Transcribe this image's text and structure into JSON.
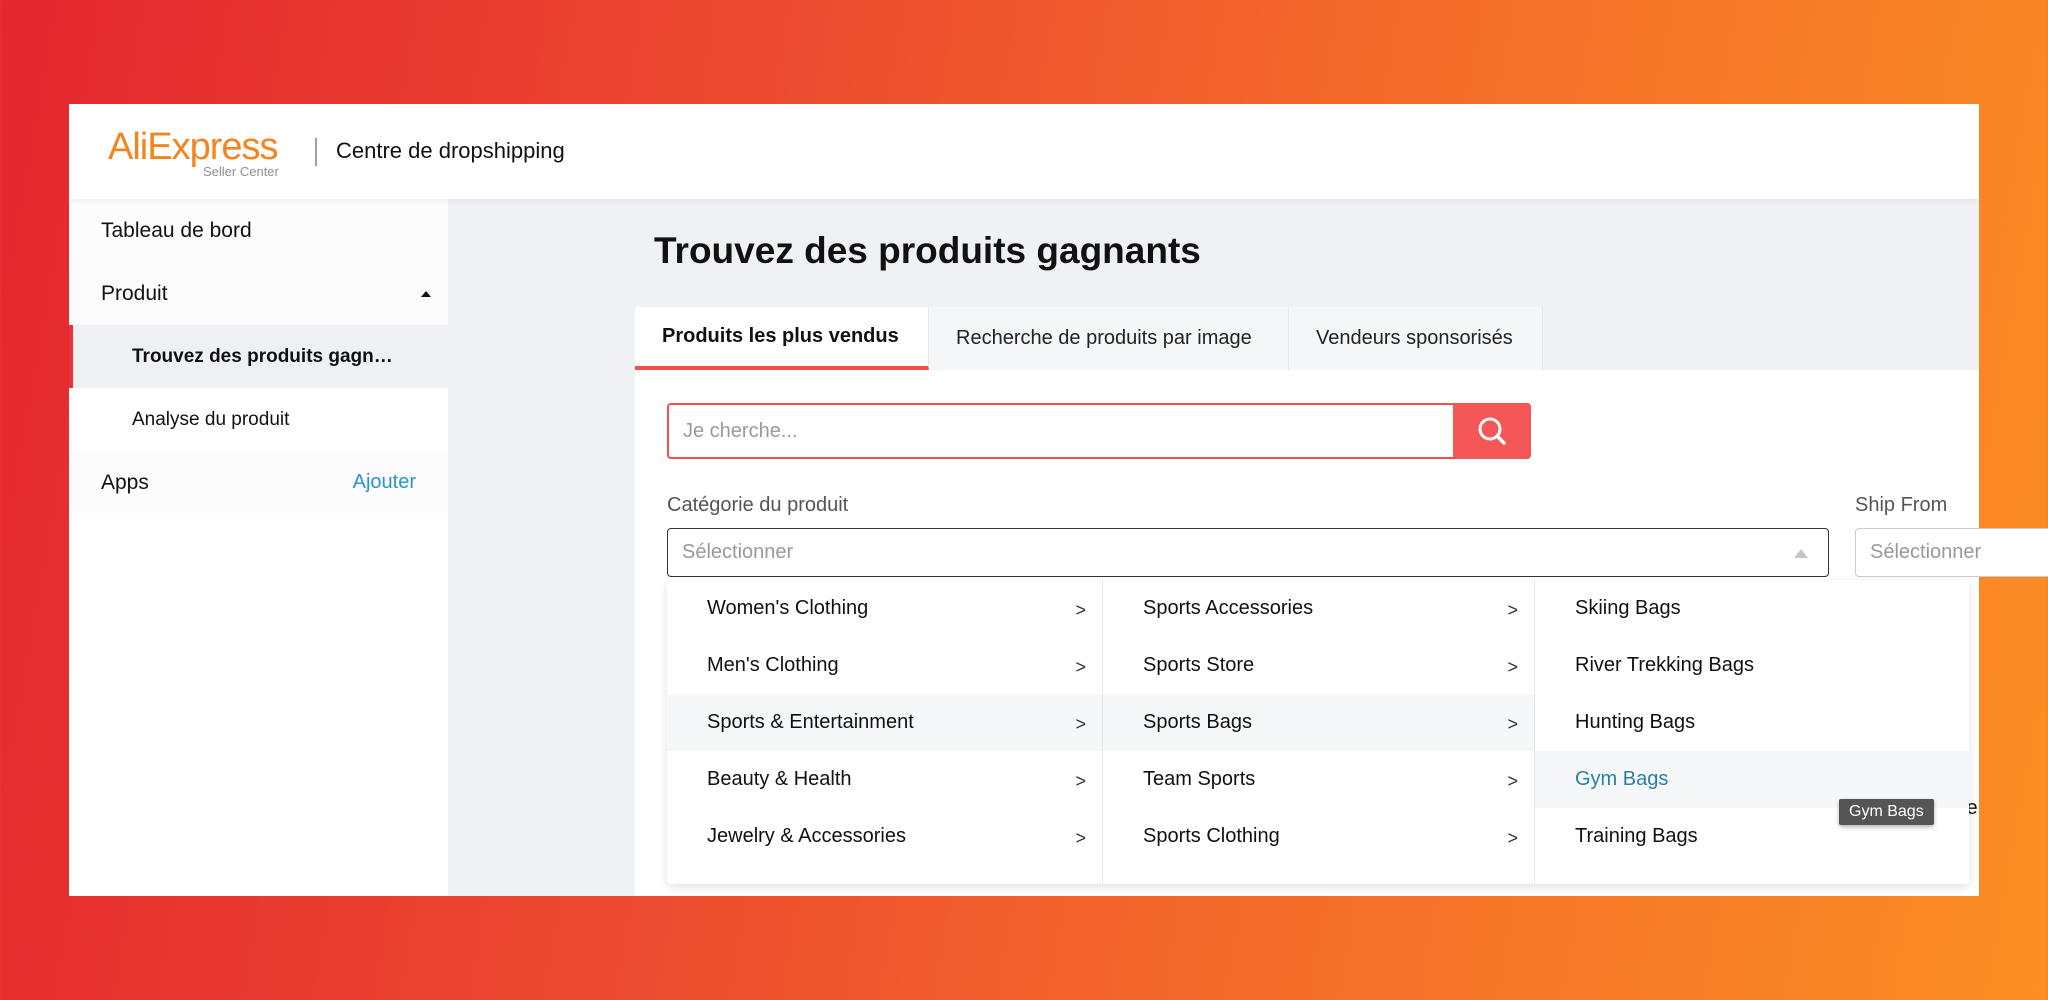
{
  "header": {
    "logo_text": "AliExpress",
    "logo_sub": "Seller Center",
    "title": "Centre de dropshipping"
  },
  "sidebar": {
    "items": [
      {
        "label": "Tableau de bord"
      },
      {
        "label": "Produit"
      },
      {
        "label": "Trouvez des produits gagn…"
      },
      {
        "label": "Analyse du produit"
      },
      {
        "label": "Apps",
        "action": "Ajouter"
      }
    ]
  },
  "main": {
    "title": "Trouvez des produits gagnants",
    "tabs": [
      {
        "label": "Produits les plus vendus"
      },
      {
        "label": "Recherche de produits par image"
      },
      {
        "label": "Vendeurs sponsorisés"
      }
    ],
    "search": {
      "placeholder": "Je cherche..."
    },
    "category": {
      "label": "Catégorie du produit",
      "placeholder": "Sélectionner"
    },
    "ship_from": {
      "label": "Ship From",
      "placeholder": "Sélectionner"
    },
    "dropdown": {
      "col1": [
        "Women's Clothing",
        "Men's Clothing",
        "Sports & Entertainment",
        "Beauty & Health",
        "Jewelry & Accessories"
      ],
      "col2": [
        "Sports Accessories",
        "Sports Store",
        "Sports Bags",
        "Team Sports",
        "Sports Clothing"
      ],
      "col3": [
        "Skiing Bags",
        "River Trekking Bags",
        "Hunting Bags",
        "Gym Bags",
        "Training Bags"
      ]
    },
    "tooltip": "Gym Bags",
    "peek_text": "te"
  },
  "colors": {
    "accent": "#f05050",
    "link": "#2a94c4",
    "selected": "#2b7fa6"
  }
}
